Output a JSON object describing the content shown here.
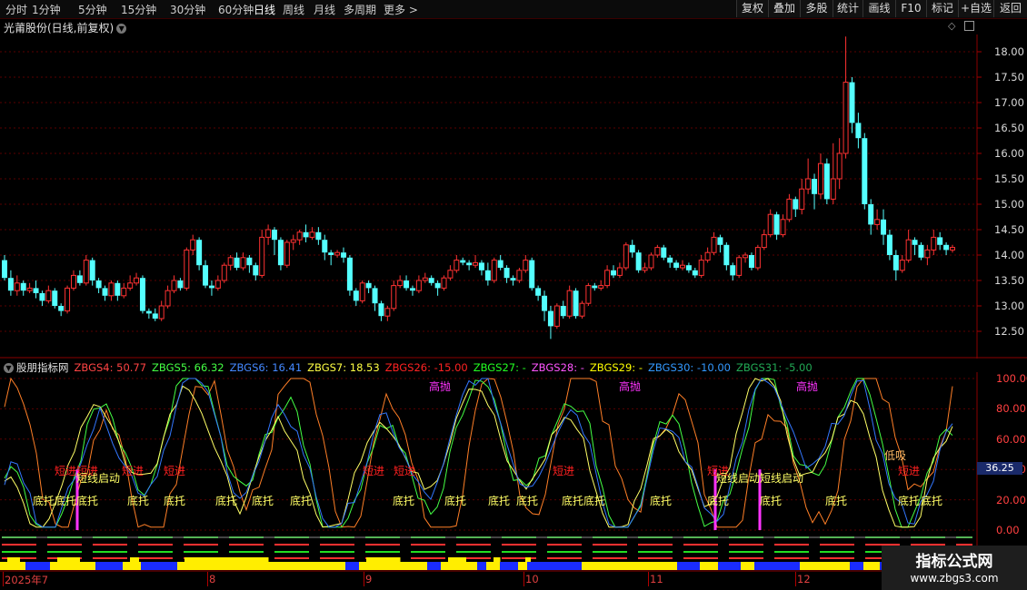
{
  "toolbar": {
    "timeframes": [
      "分时",
      "1分钟",
      "5分钟",
      "15分钟",
      "30分钟",
      "60分钟",
      "日线",
      "周线",
      "月线",
      "多周期",
      "更多 >"
    ],
    "active_timeframe": "日线",
    "right_buttons": [
      "复权",
      "叠加",
      "多股",
      "统计",
      "画线",
      "F10",
      "标记",
      "+自选",
      "返回"
    ]
  },
  "main": {
    "title": "光莆股份(日线,前复权)",
    "price_axis": [
      "18.00",
      "17.50",
      "17.00",
      "16.50",
      "16.00",
      "15.50",
      "15.00",
      "14.50",
      "14.00",
      "13.50",
      "13.00",
      "12.50"
    ],
    "candles": [
      [
        13.9,
        13.55,
        14.0,
        13.5
      ],
      [
        13.55,
        13.3,
        13.7,
        13.2
      ],
      [
        13.3,
        13.45,
        13.6,
        13.2
      ],
      [
        13.45,
        13.3,
        13.5,
        13.2
      ],
      [
        13.3,
        13.35,
        13.45,
        13.25
      ],
      [
        13.35,
        13.25,
        13.5,
        13.15
      ],
      [
        13.25,
        13.1,
        13.3,
        13.0
      ],
      [
        13.1,
        13.3,
        13.4,
        13.05
      ],
      [
        13.3,
        13.0,
        13.35,
        12.95
      ],
      [
        13.0,
        12.9,
        13.05,
        12.8
      ],
      [
        12.9,
        13.35,
        13.4,
        12.85
      ],
      [
        13.35,
        13.6,
        13.7,
        13.3
      ],
      [
        13.6,
        13.45,
        13.7,
        13.4
      ],
      [
        13.45,
        13.9,
        14.0,
        13.4
      ],
      [
        13.9,
        13.5,
        13.95,
        13.4
      ],
      [
        13.5,
        13.35,
        13.55,
        13.25
      ],
      [
        13.35,
        13.2,
        13.4,
        13.1
      ],
      [
        13.2,
        13.45,
        13.5,
        13.1
      ],
      [
        13.45,
        13.2,
        13.5,
        13.1
      ],
      [
        13.2,
        13.35,
        13.45,
        13.15
      ],
      [
        13.35,
        13.45,
        13.6,
        13.3
      ],
      [
        13.45,
        13.55,
        13.65,
        13.4
      ],
      [
        13.55,
        12.9,
        13.6,
        12.85
      ],
      [
        12.9,
        12.85,
        12.95,
        12.75
      ],
      [
        12.85,
        12.75,
        12.95,
        12.7
      ],
      [
        12.75,
        13.0,
        13.1,
        12.7
      ],
      [
        13.0,
        13.3,
        13.4,
        12.95
      ],
      [
        13.3,
        13.5,
        13.6,
        13.25
      ],
      [
        13.5,
        13.35,
        13.55,
        13.3
      ],
      [
        13.35,
        14.1,
        14.15,
        13.3
      ],
      [
        14.1,
        14.3,
        14.4,
        14.0
      ],
      [
        14.3,
        13.8,
        14.35,
        13.7
      ],
      [
        13.8,
        13.4,
        13.9,
        13.35
      ],
      [
        13.4,
        13.35,
        13.5,
        13.2
      ],
      [
        13.35,
        13.5,
        13.6,
        13.3
      ],
      [
        13.5,
        13.8,
        13.85,
        13.45
      ],
      [
        13.8,
        13.95,
        14.0,
        13.7
      ],
      [
        13.95,
        13.75,
        14.05,
        13.7
      ],
      [
        13.75,
        13.95,
        14.05,
        13.7
      ],
      [
        13.95,
        13.8,
        14.0,
        13.65
      ],
      [
        13.8,
        13.6,
        13.85,
        13.5
      ],
      [
        13.6,
        14.35,
        14.5,
        13.55
      ],
      [
        14.35,
        14.5,
        14.6,
        14.2
      ],
      [
        14.5,
        14.3,
        14.55,
        14.0
      ],
      [
        14.3,
        13.8,
        14.35,
        13.7
      ],
      [
        13.8,
        14.25,
        14.3,
        13.75
      ],
      [
        14.25,
        14.3,
        14.4,
        14.1
      ],
      [
        14.3,
        14.45,
        14.5,
        14.2
      ],
      [
        14.45,
        14.35,
        14.6,
        14.25
      ],
      [
        14.35,
        14.45,
        14.55,
        14.3
      ],
      [
        14.45,
        14.3,
        14.55,
        14.2
      ],
      [
        14.3,
        14.05,
        14.4,
        13.9
      ],
      [
        14.05,
        14.0,
        14.1,
        13.8
      ],
      [
        14.0,
        14.05,
        14.1,
        13.95
      ],
      [
        14.05,
        13.95,
        14.15,
        13.85
      ],
      [
        13.95,
        13.3,
        14.0,
        13.2
      ],
      [
        13.3,
        13.1,
        13.35,
        13.0
      ],
      [
        13.1,
        13.45,
        13.5,
        13.05
      ],
      [
        13.45,
        13.35,
        13.5,
        13.25
      ],
      [
        13.35,
        13.05,
        13.4,
        12.9
      ],
      [
        13.05,
        12.8,
        13.1,
        12.7
      ],
      [
        12.8,
        12.95,
        13.0,
        12.7
      ],
      [
        12.95,
        13.4,
        13.5,
        12.9
      ],
      [
        13.4,
        13.5,
        13.6,
        13.35
      ],
      [
        13.5,
        13.35,
        13.6,
        13.3
      ],
      [
        13.35,
        13.3,
        13.4,
        13.2
      ],
      [
        13.3,
        13.5,
        13.6,
        13.25
      ],
      [
        13.5,
        13.55,
        13.65,
        13.45
      ],
      [
        13.55,
        13.45,
        13.6,
        13.4
      ],
      [
        13.45,
        13.35,
        13.5,
        13.2
      ],
      [
        13.35,
        13.55,
        13.6,
        13.3
      ],
      [
        13.55,
        13.7,
        13.8,
        13.5
      ],
      [
        13.7,
        13.9,
        14.0,
        13.65
      ],
      [
        13.9,
        13.85,
        13.95,
        13.8
      ],
      [
        13.85,
        13.8,
        13.9,
        13.7
      ],
      [
        13.8,
        13.85,
        14.0,
        13.75
      ],
      [
        13.85,
        13.7,
        13.9,
        13.6
      ],
      [
        13.7,
        13.5,
        13.85,
        13.4
      ],
      [
        13.5,
        13.9,
        13.95,
        13.45
      ],
      [
        13.9,
        13.75,
        14.0,
        13.7
      ],
      [
        13.75,
        13.55,
        13.8,
        13.45
      ],
      [
        13.55,
        13.5,
        13.6,
        13.4
      ],
      [
        13.5,
        13.7,
        13.75,
        13.45
      ],
      [
        13.7,
        13.9,
        14.0,
        13.65
      ],
      [
        13.9,
        13.35,
        13.95,
        13.3
      ],
      [
        13.35,
        13.2,
        13.4,
        13.1
      ],
      [
        13.2,
        12.9,
        13.3,
        12.7
      ],
      [
        12.9,
        12.6,
        13.0,
        12.35
      ],
      [
        12.6,
        13.0,
        13.05,
        12.55
      ],
      [
        13.0,
        12.8,
        13.1,
        12.75
      ],
      [
        12.8,
        13.3,
        13.4,
        12.75
      ],
      [
        13.3,
        12.8,
        13.35,
        12.75
      ],
      [
        12.8,
        13.05,
        13.1,
        12.75
      ],
      [
        13.05,
        13.4,
        13.45,
        13.0
      ],
      [
        13.4,
        13.35,
        13.45,
        13.3
      ],
      [
        13.35,
        13.4,
        13.5,
        13.3
      ],
      [
        13.4,
        13.7,
        13.8,
        13.35
      ],
      [
        13.7,
        13.6,
        13.8,
        13.55
      ],
      [
        13.6,
        13.75,
        13.85,
        13.55
      ],
      [
        13.75,
        14.2,
        14.25,
        13.7
      ],
      [
        14.2,
        14.05,
        14.3,
        13.95
      ],
      [
        14.05,
        13.7,
        14.1,
        13.65
      ],
      [
        13.7,
        13.75,
        13.85,
        13.65
      ],
      [
        13.75,
        14.0,
        14.05,
        13.7
      ],
      [
        14.0,
        14.15,
        14.2,
        13.95
      ],
      [
        14.15,
        13.95,
        14.2,
        13.9
      ],
      [
        13.95,
        13.85,
        14.0,
        13.75
      ],
      [
        13.85,
        13.75,
        13.9,
        13.7
      ],
      [
        13.75,
        13.8,
        13.9,
        13.7
      ],
      [
        13.8,
        13.7,
        13.85,
        13.65
      ],
      [
        13.7,
        13.6,
        13.75,
        13.55
      ],
      [
        13.6,
        13.9,
        14.0,
        13.55
      ],
      [
        13.9,
        14.05,
        14.15,
        13.85
      ],
      [
        14.05,
        14.35,
        14.45,
        14.0
      ],
      [
        14.35,
        14.2,
        14.4,
        14.05
      ],
      [
        14.2,
        13.8,
        14.25,
        13.7
      ],
      [
        13.8,
        13.6,
        13.85,
        13.5
      ],
      [
        13.6,
        13.95,
        14.0,
        13.55
      ],
      [
        13.95,
        14.0,
        14.05,
        13.85
      ],
      [
        14.0,
        13.75,
        14.05,
        13.7
      ],
      [
        13.75,
        14.15,
        14.2,
        13.7
      ],
      [
        14.15,
        14.4,
        14.5,
        14.1
      ],
      [
        14.4,
        14.8,
        14.9,
        14.35
      ],
      [
        14.8,
        14.4,
        14.85,
        14.3
      ],
      [
        14.4,
        14.7,
        14.8,
        14.35
      ],
      [
        14.7,
        15.1,
        15.2,
        14.65
      ],
      [
        15.1,
        14.9,
        15.15,
        14.75
      ],
      [
        14.9,
        15.3,
        15.5,
        14.8
      ],
      [
        15.3,
        15.5,
        15.9,
        15.2
      ],
      [
        15.5,
        15.2,
        15.6,
        14.9
      ],
      [
        15.2,
        15.8,
        16.0,
        15.1
      ],
      [
        15.8,
        15.1,
        15.9,
        15.0
      ],
      [
        15.1,
        15.5,
        16.2,
        15.0
      ],
      [
        15.5,
        16.0,
        16.3,
        15.3
      ],
      [
        16.0,
        17.4,
        18.3,
        15.9
      ],
      [
        17.4,
        16.6,
        17.5,
        16.4
      ],
      [
        16.6,
        16.3,
        16.8,
        16.1
      ],
      [
        16.3,
        15.0,
        16.4,
        14.9
      ],
      [
        15.0,
        14.6,
        15.1,
        14.4
      ],
      [
        14.6,
        14.7,
        14.9,
        14.5
      ],
      [
        14.7,
        14.4,
        14.9,
        14.2
      ],
      [
        14.4,
        14.0,
        14.5,
        13.9
      ],
      [
        14.0,
        13.7,
        14.1,
        13.5
      ],
      [
        13.7,
        13.9,
        14.0,
        13.65
      ],
      [
        13.9,
        14.3,
        14.5,
        13.85
      ],
      [
        14.3,
        14.2,
        14.35,
        14.0
      ],
      [
        14.2,
        13.95,
        14.25,
        13.9
      ],
      [
        13.95,
        14.1,
        14.2,
        13.8
      ],
      [
        14.1,
        14.35,
        14.5,
        14.0
      ],
      [
        14.35,
        14.2,
        14.45,
        14.1
      ],
      [
        14.2,
        14.1,
        14.25,
        14.0
      ],
      [
        14.1,
        14.15,
        14.2,
        14.05
      ]
    ]
  },
  "indicator": {
    "header": [
      {
        "text": "股朋指标网",
        "color": "#e0e0e0"
      },
      {
        "text": "ZBGS4: 50.77",
        "color": "#ff4444"
      },
      {
        "text": "ZBGS5: 66.32",
        "color": "#44ff44"
      },
      {
        "text": "ZBGS6: 16.41",
        "color": "#4488ff"
      },
      {
        "text": "ZBGS7: 18.53",
        "color": "#ffff44"
      },
      {
        "text": "ZBGS26: -15.00",
        "color": "#ff2222"
      },
      {
        "text": "ZBGS27: -",
        "color": "#22ff22"
      },
      {
        "text": "ZBGS28: -",
        "color": "#ff55ff"
      },
      {
        "text": "ZBGS29: -",
        "color": "#ffff00"
      },
      {
        "text": "ZBGS30: -10.00",
        "color": "#3399ff"
      },
      {
        "text": "ZBGS31: -5.00",
        "color": "#22aa55"
      }
    ],
    "axis": [
      "100.00",
      "80.00",
      "60.00",
      "40.00",
      "20.00",
      "0.00"
    ],
    "current_value": "36.25",
    "labels": {
      "bottom": "底托",
      "buy": "短进",
      "start": "短线启动",
      "top": "高抛",
      "low": "低吸"
    },
    "colors": {
      "orange": "#ff7f27",
      "green": "#44ff44",
      "yellow": "#ffff66",
      "blue": "#3377ff",
      "pink": "#ff33ff",
      "red": "#ff2020"
    }
  },
  "xaxis": [
    "2025年7",
    "8",
    "9",
    "10",
    "11",
    "12"
  ],
  "watermark": {
    "title": "指标公式网",
    "url": "www.zbgs3.com"
  }
}
